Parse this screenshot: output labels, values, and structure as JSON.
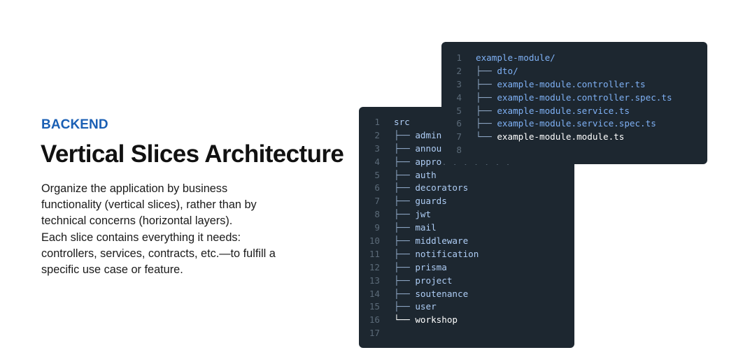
{
  "section": {
    "eyebrow": "BACKEND",
    "title": "Vertical Slices Architecture",
    "description_lines": [
      "Organize the application by business",
      "functionality (vertical slices), rather than by",
      "technical concerns (horizontal layers).",
      "Each slice contains everything it needs:",
      "controllers, services, contracts, etc.—to fulfill a",
      "specific use case or feature."
    ]
  },
  "src_tree": {
    "line_numbers": [
      "1",
      "2",
      "3",
      "4",
      "5",
      "6",
      "7",
      "8",
      "9",
      "10",
      "11",
      "12",
      "13",
      "14",
      "15",
      "16",
      "17"
    ],
    "root": "src",
    "items": [
      {
        "prefix": "├── ",
        "name": "admin"
      },
      {
        "prefix": "├── ",
        "name": "annou"
      },
      {
        "prefix": "├── ",
        "name": "appro",
        "trail": ". . . . . . ."
      },
      {
        "prefix": "├── ",
        "name": "auth"
      },
      {
        "prefix": "├── ",
        "name": "decorators"
      },
      {
        "prefix": "├── ",
        "name": "guards"
      },
      {
        "prefix": "├── ",
        "name": "jwt"
      },
      {
        "prefix": "├── ",
        "name": "mail"
      },
      {
        "prefix": "├── ",
        "name": "middleware"
      },
      {
        "prefix": "├── ",
        "name": "notification"
      },
      {
        "prefix": "├── ",
        "name": "prisma"
      },
      {
        "prefix": "├── ",
        "name": "project"
      },
      {
        "prefix": "├── ",
        "name": "soutenance"
      },
      {
        "prefix": "├── ",
        "name": "user"
      },
      {
        "prefix": "└── ",
        "name": "workshop"
      }
    ]
  },
  "module_tree": {
    "line_numbers": [
      "1",
      "2",
      "3",
      "4",
      "5",
      "6",
      "7",
      "8"
    ],
    "root": "example-module/",
    "items": [
      {
        "prefix": "├── ",
        "name": "dto/"
      },
      {
        "prefix": "├── ",
        "name": "example-module.controller.ts"
      },
      {
        "prefix": "├── ",
        "name": "example-module.controller.spec.ts"
      },
      {
        "prefix": "├── ",
        "name": "example-module.service.ts"
      },
      {
        "prefix": "├── ",
        "name": "example-module.service.spec.ts"
      },
      {
        "prefix": "└── ",
        "name": "example-module.module.ts"
      }
    ]
  },
  "colors": {
    "accent": "#1a5fb4",
    "panel_bg": "#1d2730",
    "code_text": "#aecdf5",
    "line_number": "#5b6a78"
  }
}
